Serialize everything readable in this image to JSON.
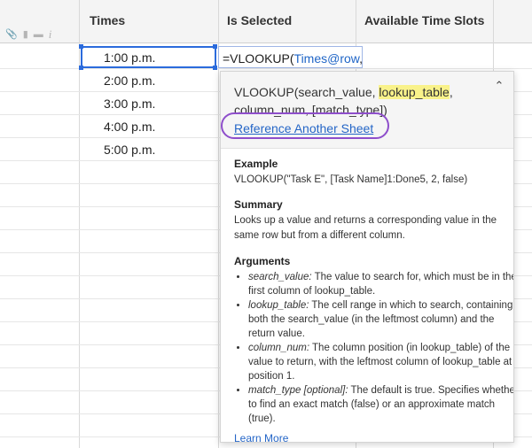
{
  "columns": {
    "times": "Times",
    "is_selected": "Is Selected",
    "available_time_slots": "Available Time Slots"
  },
  "row_icons": [
    "attachment-icon",
    "comment-icon",
    "proof-icon",
    "info-icon"
  ],
  "times_values": [
    "1:00 p.m.",
    "2:00 p.m.",
    "3:00 p.m.",
    "4:00 p.m.",
    "5:00 p.m."
  ],
  "formula": {
    "prefix": "=VLOOKUP(",
    "reference": "Times@row",
    "suffix": ","
  },
  "popup": {
    "signature_part1": "VLOOKUP(search_value, ",
    "signature_highlight": "lookup_table",
    "signature_part2": ",",
    "signature_line2": "column_num, [match_type])",
    "reference_link": "Reference Another Sheet",
    "example_title": "Example",
    "example_text": "VLOOKUP(\"Task E\", [Task Name]1:Done5, 2, false)",
    "summary_title": "Summary",
    "summary_text": "Looks up a value and returns a corresponding value in the same row but from a different column.",
    "arguments_title": "Arguments",
    "arguments": [
      {
        "name": "search_value:",
        "text": " The value to search for, which must be in the first column of lookup_table."
      },
      {
        "name": "lookup_table:",
        "text": " The cell range in which to search, containing both the search_value (in the leftmost column) and the return value."
      },
      {
        "name": "column_num:",
        "text": " The column position (in lookup_table) of the value to return, with the leftmost column of lookup_table at position 1."
      },
      {
        "name": "match_type [optional]:",
        "text": " The default is true. Specifies whether to find an exact match (false) or an approximate match (true)."
      }
    ],
    "learn_more": "Learn More"
  },
  "colors": {
    "selection": "#2b6bdc",
    "highlight": "#f9f28a",
    "link": "#2566c7",
    "annotation_ring": "#8e4ecb"
  }
}
